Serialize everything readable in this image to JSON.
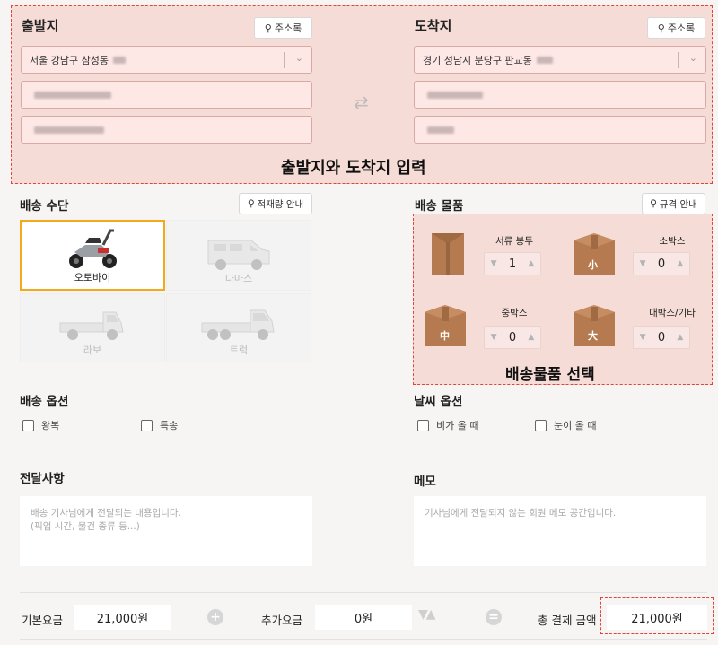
{
  "origin": {
    "title": "출발지",
    "addr_book_label": "주소록",
    "address": "서울 강남구 삼성동"
  },
  "destination": {
    "title": "도착지",
    "addr_book_label": "주소록",
    "address": "경기 성남시 분당구 판교동"
  },
  "address_overlay_label": "출발지와 도착지 입력",
  "transport": {
    "title": "배송 수단",
    "guide_label": "적재량 안내",
    "vehicles": [
      {
        "label": "오토바이",
        "selected": true
      },
      {
        "label": "다마스",
        "selected": false
      },
      {
        "label": "라보",
        "selected": false
      },
      {
        "label": "트럭",
        "selected": false
      }
    ]
  },
  "items": {
    "title": "배송 물품",
    "guide_label": "규격 안내",
    "overlay_label": "배송물품 선택",
    "list": [
      {
        "name": "서류 봉투",
        "qty": "1",
        "badge": ""
      },
      {
        "name": "소박스",
        "qty": "0",
        "badge": "小"
      },
      {
        "name": "중박스",
        "qty": "0",
        "badge": "中"
      },
      {
        "name": "대박스/기타",
        "qty": "0",
        "badge": "大"
      }
    ]
  },
  "delivery_options": {
    "title": "배송 옵션",
    "options": [
      "왕복",
      "특송"
    ]
  },
  "weather_options": {
    "title": "날씨 옵션",
    "options": [
      "비가 올 때",
      "눈이 올 때"
    ]
  },
  "message": {
    "title": "전달사항",
    "placeholder": "배송 기사님에게 전달되는 내용입니다.\n(픽업 시간, 물건 종류 등...)"
  },
  "memo": {
    "title": "메모",
    "placeholder": "기사님에게 전달되지 않는 회원 메모 공간입니다."
  },
  "fees": {
    "base_label": "기본요금",
    "base_value": "21,000원",
    "extra_label": "추가요금",
    "extra_value": "0원",
    "total_label": "총 결제 금액",
    "total_value": "21,000원"
  },
  "colors": {
    "highlight_border": "#e2433a",
    "selected_border": "#f2a91c",
    "box_brown": "#b57a4f"
  }
}
